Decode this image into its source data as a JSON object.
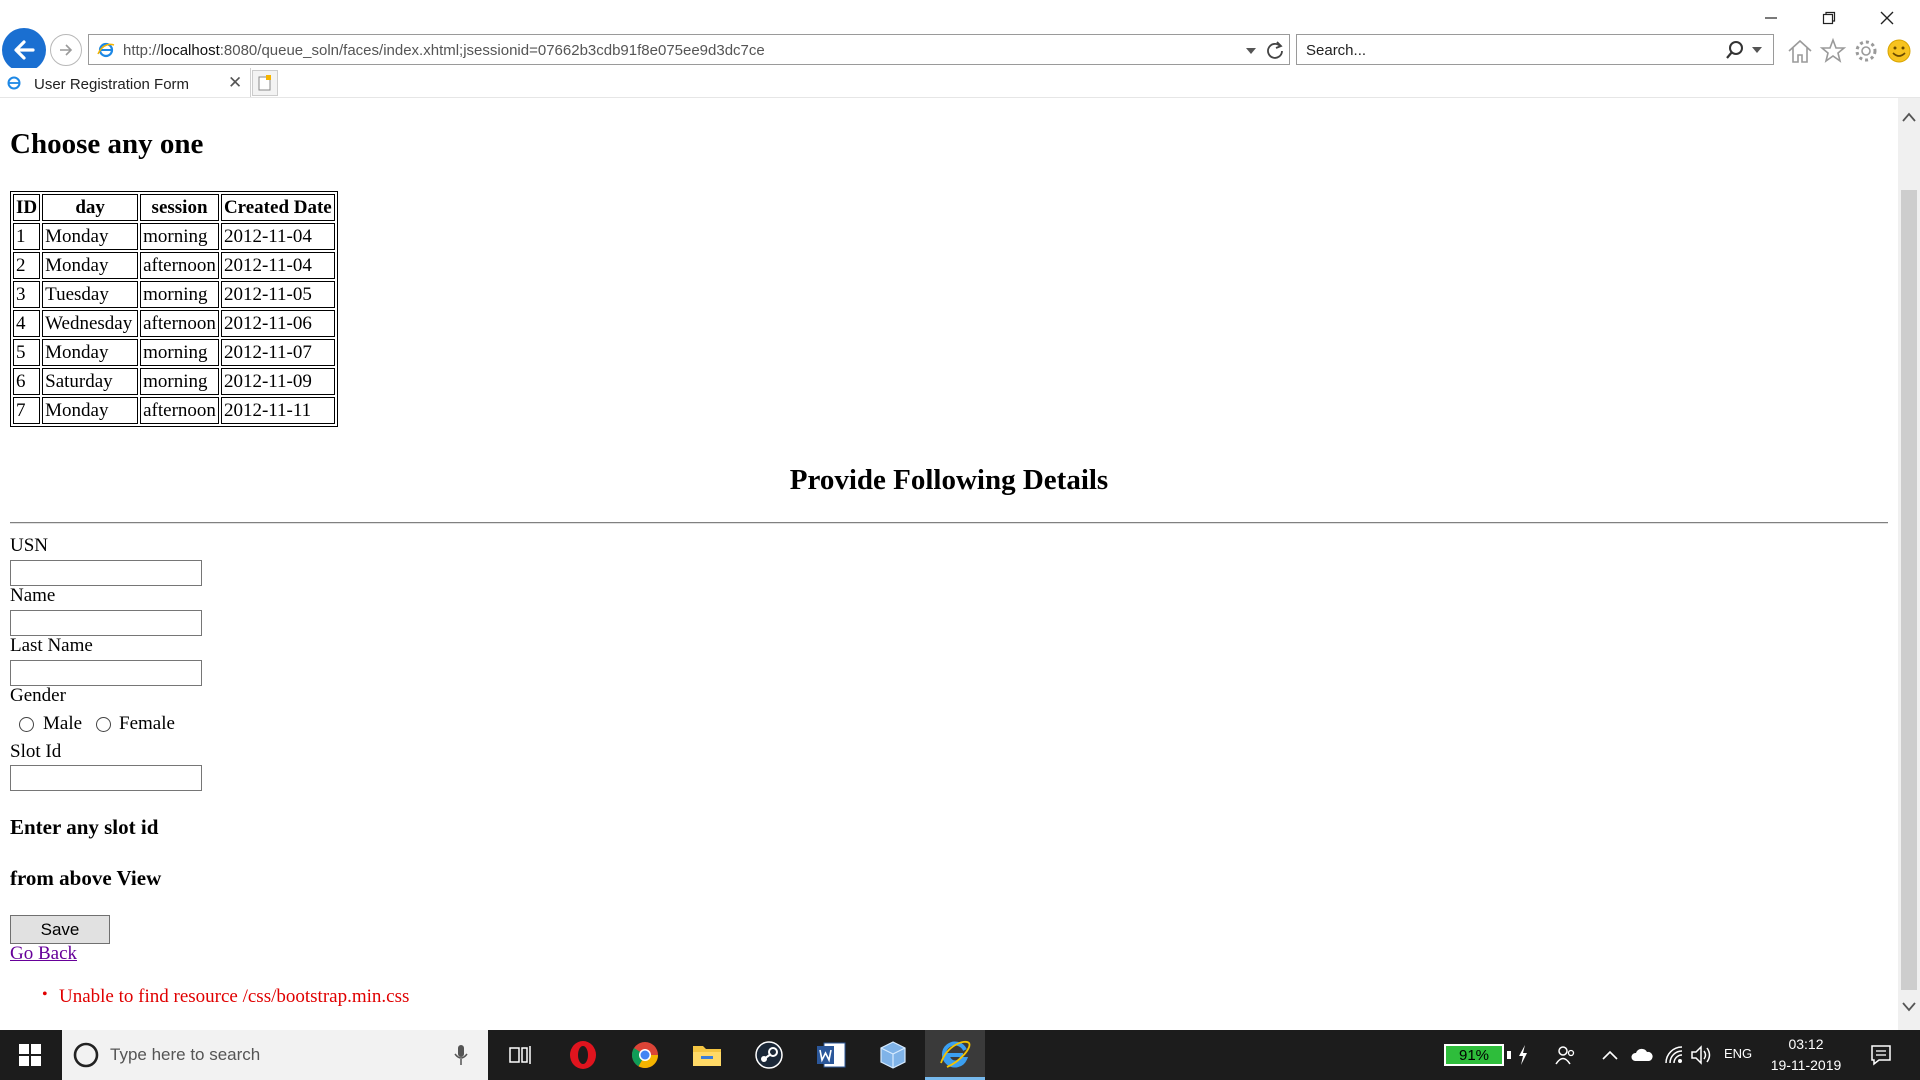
{
  "browser": {
    "address_prefix": "http://",
    "address_host": "localhost",
    "address_rest": ":8080/queue_soln/faces/index.xhtml;jsessionid=07662b3cdb91f8e075ee9d3dc7ce",
    "search_placeholder": "Search...",
    "tab_title": "User Registration Form"
  },
  "page": {
    "heading": "Choose any one",
    "table": {
      "headers": [
        "ID",
        "day",
        "session",
        "Created Date"
      ],
      "rows": [
        [
          "1",
          "Monday",
          "morning",
          "2012-11-04"
        ],
        [
          "2",
          "Monday",
          "afternoon",
          "2012-11-04"
        ],
        [
          "3",
          "Tuesday",
          "morning",
          "2012-11-05"
        ],
        [
          "4",
          "Wednesday",
          "afternoon",
          "2012-11-06"
        ],
        [
          "5",
          "Monday",
          "morning",
          "2012-11-07"
        ],
        [
          "6",
          "Saturday",
          "morning",
          "2012-11-09"
        ],
        [
          "7",
          "Monday",
          "afternoon",
          "2012-11-11"
        ]
      ]
    },
    "details_heading": "Provide Following Details",
    "usn_label": "USN",
    "name_label": "Name",
    "lastname_label": "Last Name",
    "gender_label": "Gender",
    "male_label": "Male",
    "female_label": "Female",
    "slot_label": "Slot Id",
    "hint_line1": "Enter any slot id",
    "hint_line2": "from above View",
    "save_label": "Save",
    "goback_label": "Go Back",
    "error_message": "Unable to find resource /css/bootstrap.min.css"
  },
  "taskbar": {
    "search_placeholder": "Type here to search",
    "battery": "91%",
    "language": "ENG",
    "time": "03:12",
    "date": "19-11-2019"
  },
  "colors": {
    "back_button": "#1a6fd1",
    "error_text": "#e00000",
    "visited_link": "#660099",
    "battery_fill": "#2ebd3b"
  }
}
